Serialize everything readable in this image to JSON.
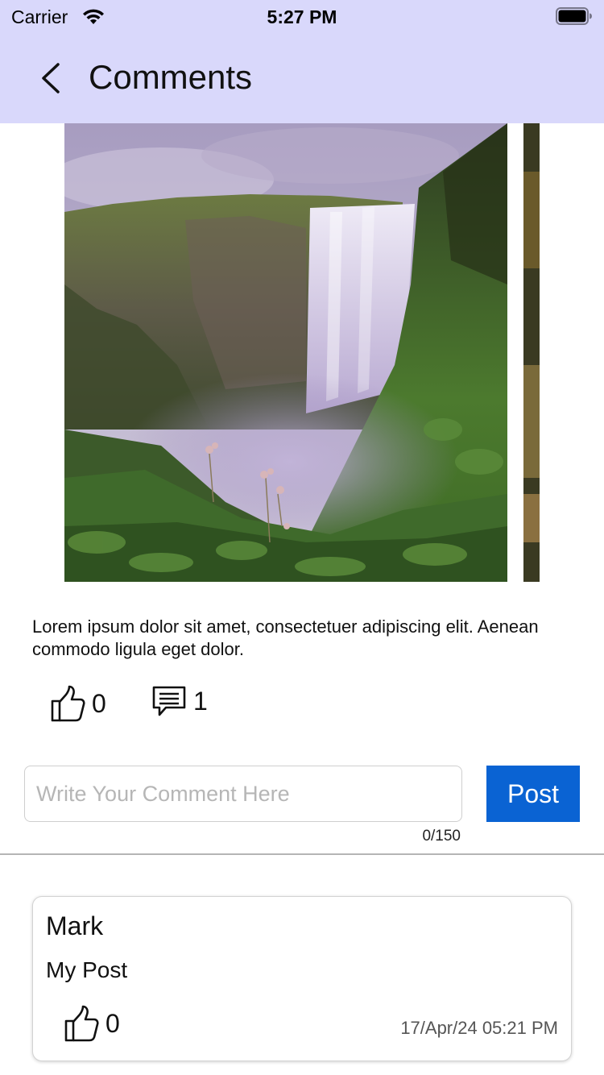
{
  "status_bar": {
    "carrier": "Carrier",
    "time": "5:27 PM"
  },
  "nav": {
    "title": "Comments",
    "background_color": "#d9d8fb"
  },
  "post": {
    "image_description_icon": "waterfall-photo",
    "description": "Lorem ipsum dolor sit amet, consectetuer adipiscing elit. Aenean commodo ligula eget dolor.",
    "like_count": "0",
    "comment_count": "1"
  },
  "comment_form": {
    "placeholder": "Write Your Comment Here",
    "value": "",
    "post_label": "Post",
    "char_count": "0/150",
    "post_button_color": "#0a63d3"
  },
  "comments": [
    {
      "author": "Mark",
      "text": "My Post",
      "like_count": "0",
      "date": "17/Apr/24 05:21 PM"
    }
  ]
}
